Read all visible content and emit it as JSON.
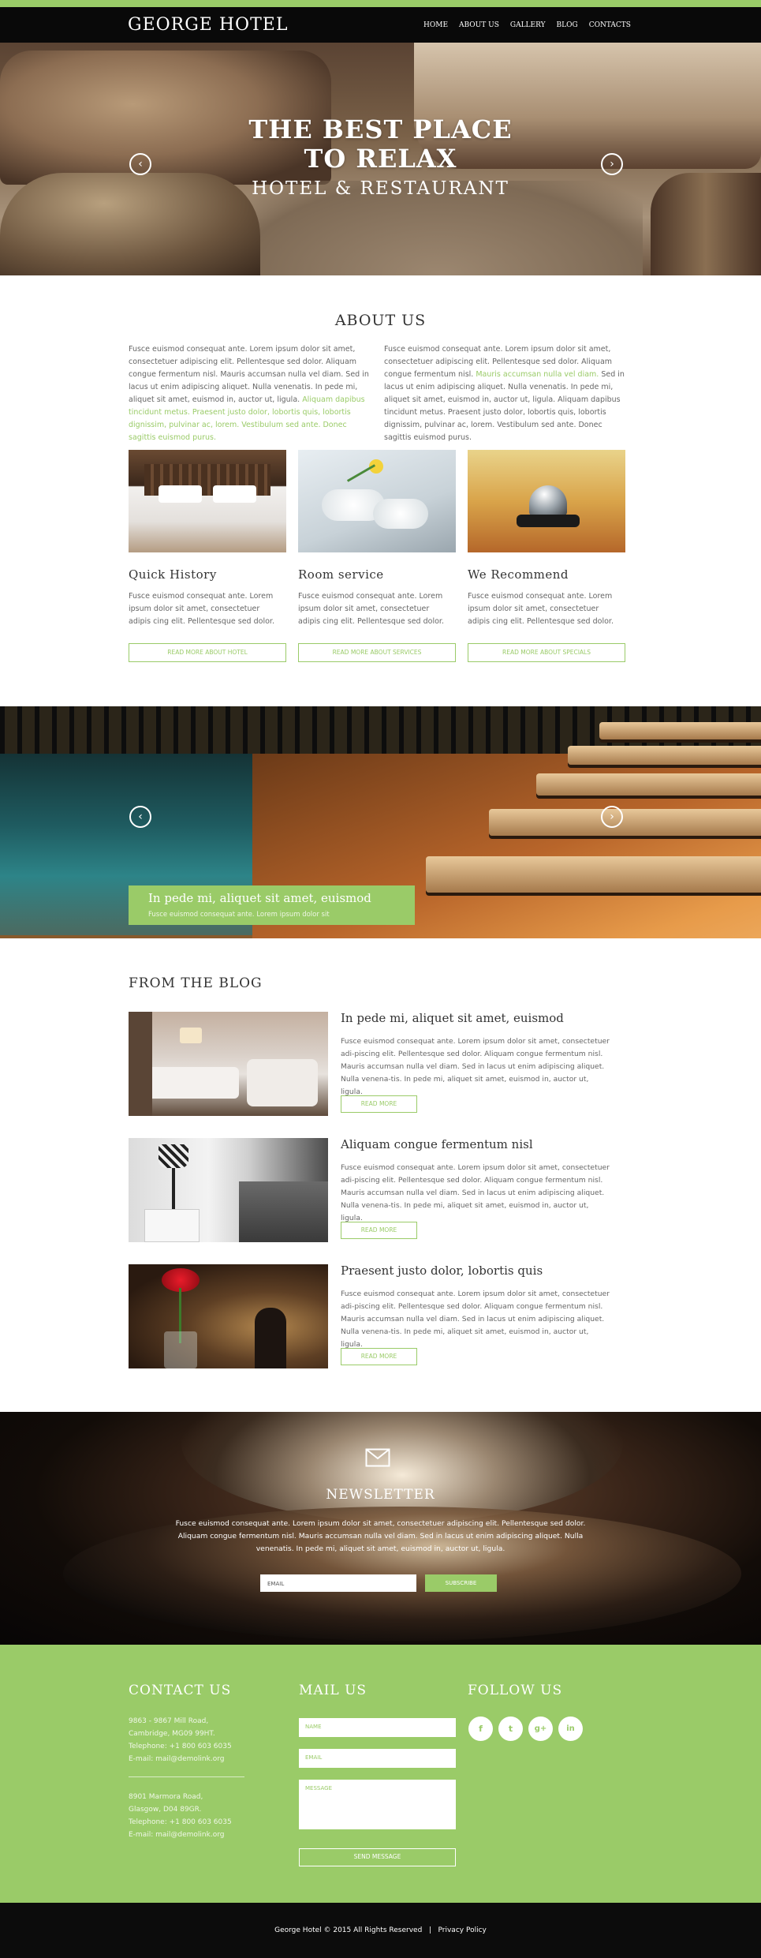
{
  "header": {
    "logo": "GEORGE HOTEL",
    "nav": [
      {
        "label": "HOME"
      },
      {
        "label": "ABOUT US"
      },
      {
        "label": "GALLERY"
      },
      {
        "label": "BLOG"
      },
      {
        "label": "CONTACTS"
      }
    ]
  },
  "hero": {
    "title_line1": "THE BEST PLACE",
    "title_line2": "TO RELAX",
    "subtitle": "HOTEL & RESTAURANT",
    "prev_icon": "‹",
    "next_icon": "›"
  },
  "about": {
    "title": "ABOUT US",
    "left_text": "Fusce euismod consequat ante. Lorem ipsum dolor sit amet, consectetuer adipiscing elit. Pellentesque sed dolor. Aliquam congue fermentum nisl. Mauris accumsan nulla vel diam. Sed in lacus ut enim adipiscing aliquet. Nulla venenatis. In pede mi, aliquet sit amet, euismod in, auctor ut, ligula.",
    "left_link": "Aliquam dapibus tincidunt metus. Praesent justo dolor, lobortis quis, lobortis dignissim, pulvinar ac, lorem. Vestibulum sed ante. Donec sagittis euismod purus.",
    "right_text_a": "Fusce euismod consequat ante. Lorem ipsum dolor sit amet, consectetuer adipiscing elit. Pellentesque sed dolor. Aliquam congue fermentum nisl.",
    "right_link": "Mauris accumsan nulla vel diam.",
    "right_text_b": "Sed in lacus ut enim adipiscing aliquet. Nulla venenatis. In pede mi, aliquet sit amet, euismod in, auctor ut, ligula. Aliquam dapibus tincidunt metus. Praesent justo dolor, lobortis quis, lobortis dignissim, pulvinar ac, lorem. Vestibulum sed ante. Donec sagittis euismod purus.",
    "cards": [
      {
        "title": "Quick History",
        "text": "Fusce euismod consequat ante. Lorem ipsum dolor sit amet, consectetuer adipis cing elit. Pellentesque sed dolor.",
        "button": "READ MORE ABOUT  HOTEL"
      },
      {
        "title": "Room service",
        "text": "Fusce euismod consequat ante. Lorem ipsum dolor sit amet, consectetuer adipis cing elit. Pellentesque sed dolor.",
        "button": "READ MORE ABOUT  SERVICES"
      },
      {
        "title": "We Recommend",
        "text": "Fusce euismod consequat ante. Lorem ipsum dolor sit amet, consectetuer adipis cing elit. Pellentesque sed dolor.",
        "button": "READ MORE ABOUT  SPECIALS"
      }
    ]
  },
  "pool": {
    "caption_title": "In pede mi, aliquet sit amet, euismod",
    "caption_text": "Fusce euismod consequat ante. Lorem ipsum dolor sit",
    "prev_icon": "‹",
    "next_icon": "›"
  },
  "blog": {
    "title": "FROM THE BLOG",
    "posts": [
      {
        "title": "In pede mi, aliquet sit amet, euismod",
        "text": "Fusce euismod consequat ante. Lorem ipsum dolor sit amet, consectetuer adi-piscing elit. Pellentesque sed dolor. Aliquam congue fermentum nisl. Mauris accumsan nulla vel diam. Sed in lacus ut enim adipiscing aliquet. Nulla venena-tis. In pede mi, aliquet sit amet, euismod in, auctor ut, ligula.",
        "button": "READ MORE"
      },
      {
        "title": "Aliquam congue fermentum nisl",
        "text": "Fusce euismod consequat ante. Lorem ipsum dolor sit amet, consectetuer adi-piscing elit. Pellentesque sed dolor. Aliquam congue fermentum nisl. Mauris accumsan nulla vel diam. Sed in lacus ut enim adipiscing aliquet. Nulla venena-tis. In pede mi, aliquet sit amet, euismod in, auctor ut, ligula.",
        "button": "READ MORE"
      },
      {
        "title": "Praesent justo dolor, lobortis quis",
        "text": "Fusce euismod consequat ante. Lorem ipsum dolor sit amet, consectetuer adi-piscing elit. Pellentesque sed dolor. Aliquam congue fermentum nisl. Mauris accumsan nulla vel diam. Sed in lacus ut enim adipiscing aliquet. Nulla venena-tis. In pede mi, aliquet sit amet, euismod in, auctor ut, ligula.",
        "button": "READ MORE"
      }
    ]
  },
  "newsletter": {
    "title": "NEWSLETTER",
    "text": "Fusce euismod consequat ante. Lorem ipsum dolor sit amet, consectetuer adipiscing elit. Pellentesque sed dolor. Aliquam congue fermentum nisl. Mauris accumsan nulla vel diam. Sed in lacus ut enim adipiscing aliquet. Nulla venenatis. In pede mi, aliquet sit amet, euismod in, auctor ut, ligula.",
    "email_placeholder": "EMAIL",
    "subscribe": "SUBSCRIBE"
  },
  "footer": {
    "contact_title": "CONTACT US",
    "address1": [
      "9863 - 9867 Mill Road,",
      "Cambridge, MG09 99HT.",
      "Telephone:   +1 800 603 6035",
      "E-mail: mail@demolink.org"
    ],
    "address2": [
      "8901 Marmora Road,",
      "Glasgow, D04 89GR.",
      "Telephone:   +1 800 603 6035",
      "E-mail: mail@demolink.org"
    ],
    "mail_title": "MAIL US",
    "name_placeholder": "NAME",
    "email_placeholder": "EMAIL",
    "message_placeholder": "MESSAGE",
    "send": "SEND MESSAGE",
    "follow_title": "FOLLOW US",
    "social": [
      "f",
      "t",
      "g+",
      "in"
    ]
  },
  "bottom": {
    "copyright": "George Hotel © 2015 All Rights Reserved",
    "separator": "|",
    "privacy": "Privacy Policy"
  },
  "colors": {
    "accent": "#9acb68",
    "dark": "#090909"
  }
}
